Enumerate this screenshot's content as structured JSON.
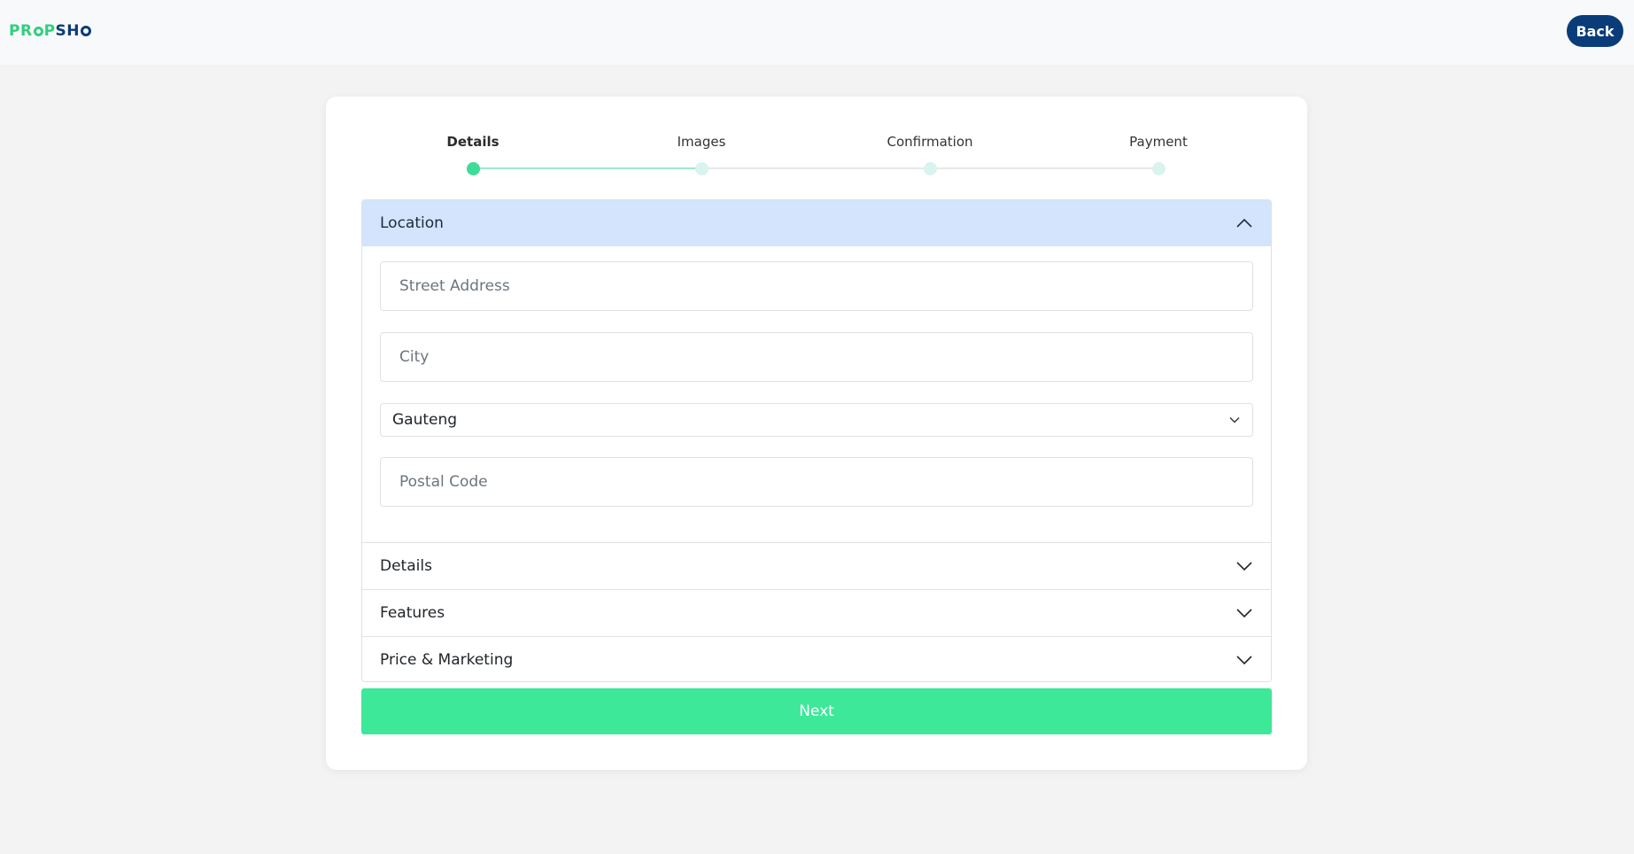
{
  "brand": {
    "logo_text_left": "PR",
    "logo_text_mid": "P",
    "logo_text_right": "SH"
  },
  "header": {
    "back_label": "Back"
  },
  "steps": [
    {
      "label": "Details",
      "active": true
    },
    {
      "label": "Images",
      "active": false
    },
    {
      "label": "Confirmation",
      "active": false
    },
    {
      "label": "Payment",
      "active": false
    }
  ],
  "accordion": {
    "location": {
      "title": "Location",
      "street_placeholder": "Street Address",
      "city_placeholder": "City",
      "province_value": "Gauteng",
      "postal_placeholder": "Postal Code"
    },
    "details_title": "Details",
    "features_title": "Features",
    "price_title": "Price & Marketing"
  },
  "actions": {
    "next_label": "Next"
  },
  "colors": {
    "accent_green": "#3de899",
    "brand_navy": "#0b3c7a",
    "open_header": "#d4e4fc"
  }
}
